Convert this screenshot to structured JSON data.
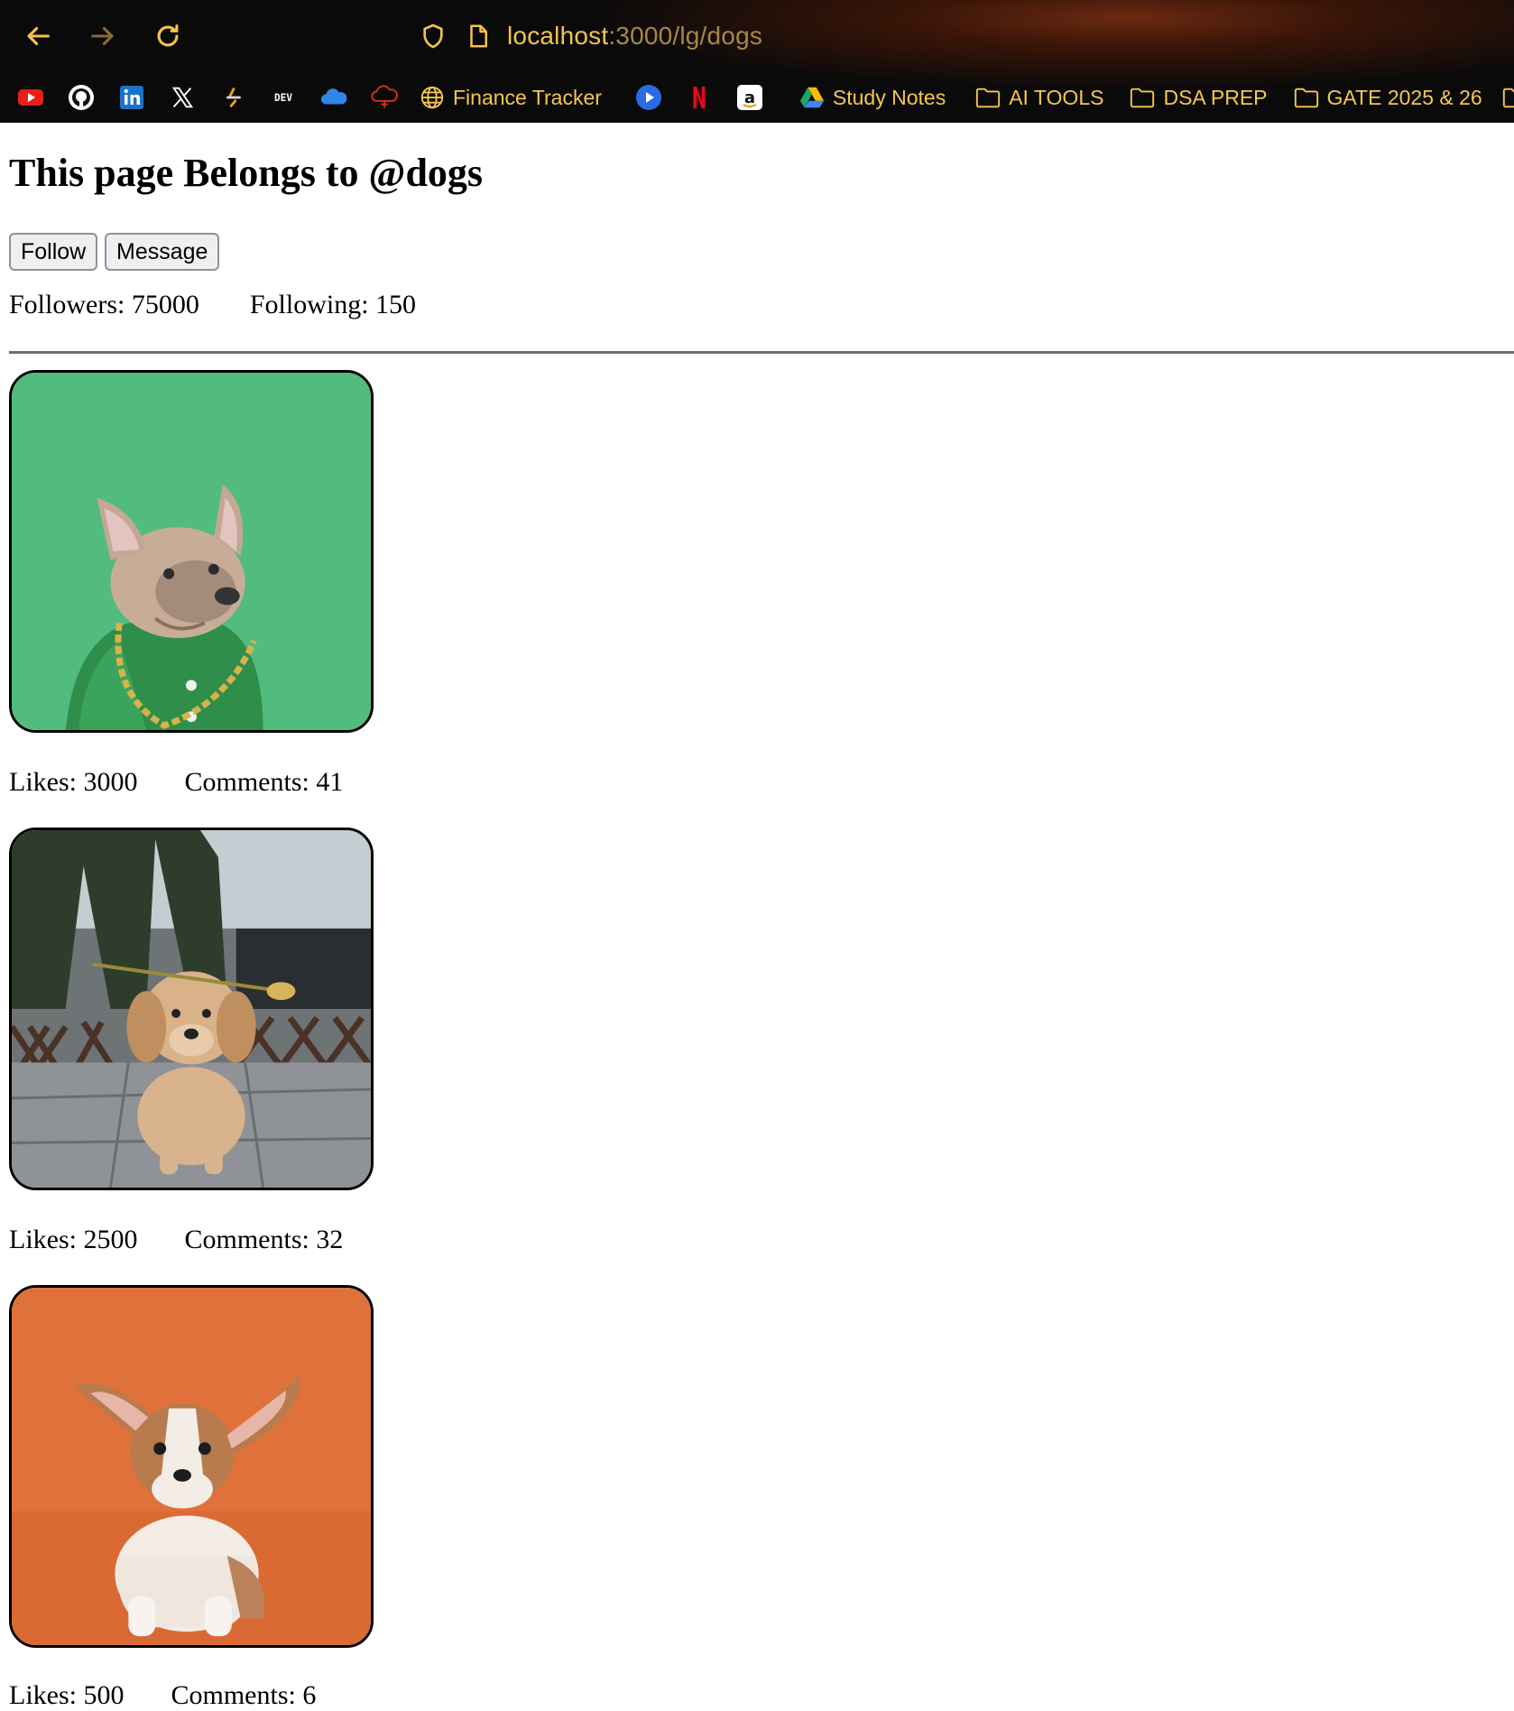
{
  "browser": {
    "url_host": "localhost",
    "url_path": ":3000/lg/dogs",
    "icons": {
      "back": "back-arrow-icon",
      "forward": "forward-arrow-icon",
      "reload": "reload-icon",
      "shield": "shield-icon",
      "page": "page-icon"
    },
    "bookmarks": [
      {
        "icon": "youtube-icon",
        "label": ""
      },
      {
        "icon": "github-icon",
        "label": ""
      },
      {
        "icon": "linkedin-icon",
        "label": ""
      },
      {
        "icon": "x-icon",
        "label": ""
      },
      {
        "icon": "codeforces-icon",
        "label": ""
      },
      {
        "icon": "dev-icon",
        "label": ""
      },
      {
        "icon": "cloud-icon",
        "label": ""
      },
      {
        "icon": "cloud-red-icon",
        "label": ""
      },
      {
        "icon": "globe-icon",
        "label": "Finance Tracker"
      },
      {
        "icon": "play-icon",
        "label": ""
      },
      {
        "icon": "netflix-icon",
        "label": ""
      },
      {
        "icon": "amazon-icon",
        "label": ""
      },
      {
        "icon": "drive-icon",
        "label": "Study Notes"
      },
      {
        "icon": "folder-icon",
        "label": "AI TOOLS"
      },
      {
        "icon": "folder-icon",
        "label": "DSA PREP"
      },
      {
        "icon": "folder-icon",
        "label": "GATE 2025 & 26"
      }
    ],
    "colors": {
      "accent": "#f6c650",
      "url_path": "#a6884a"
    }
  },
  "page": {
    "title": "This page Belongs to @dogs",
    "follow_label": "Follow",
    "message_label": "Message",
    "followers_text": "Followers: 75000",
    "following_text": "Following: 150"
  },
  "posts": [
    {
      "image": "french bulldog in green jacket with gold chain on green background",
      "likes_text": "Likes: 3000",
      "comments_text": "Comments: 41"
    },
    {
      "image": "golden puppy holding a rose stem, sitting on stone pavement",
      "likes_text": "Likes: 2500",
      "comments_text": "Comments: 32"
    },
    {
      "image": "corgi puppy on orange background",
      "likes_text": "Likes: 500",
      "comments_text": "Comments: 6"
    }
  ]
}
